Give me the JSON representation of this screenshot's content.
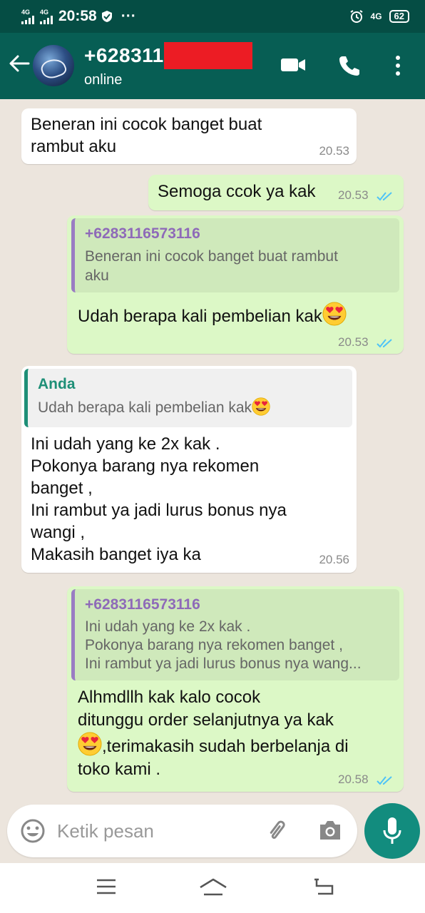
{
  "status_bar": {
    "network1": "4G",
    "network2": "4G",
    "time": "20:58",
    "dots": "···",
    "right_network": "4G",
    "battery": "62"
  },
  "header": {
    "contact": "+628311",
    "status": "online"
  },
  "messages": [
    {
      "dir": "in",
      "text_lines": [
        "Beneran ini cocok banget buat",
        "rambut aku"
      ],
      "time": "20.53"
    },
    {
      "dir": "out",
      "text": "Semoga ccok ya kak",
      "time": "20.53"
    },
    {
      "dir": "out",
      "quote_author": "+6283116573116",
      "quote_lines": [
        "Beneran ini cocok banget buat rambut",
        "aku"
      ],
      "text": "Udah berapa kali pembelian kak",
      "time": "20.53"
    },
    {
      "dir": "in",
      "quote_author": "Anda",
      "quote_text": "Udah berapa kali pembelian kak",
      "text_lines": [
        "Ini udah yang ke 2x kak .",
        "Pokonya barang nya rekomen",
        "banget ,",
        "Ini rambut ya jadi lurus bonus nya",
        "wangi ,",
        "Makasih banget iya ka"
      ],
      "time": "20.56"
    },
    {
      "dir": "out",
      "quote_author": "+6283116573116",
      "quote_lines": [
        "Ini udah yang ke 2x kak .",
        "Pokonya barang nya rekomen banget ,",
        "Ini rambut ya jadi lurus bonus nya wang..."
      ],
      "text_lines": [
        "Alhmdllh kak kalo cocok",
        "ditunggu order selanjutnya ya kak",
        ",terimakasih sudah berbelanja di",
        "toko kami ."
      ],
      "time": "20.58"
    }
  ],
  "input": {
    "placeholder": "Ketik pesan"
  },
  "icons": [
    "back-arrow-icon",
    "video-call-icon",
    "phone-icon",
    "more-options-icon",
    "emoji-icon",
    "attach-icon",
    "camera-icon",
    "mic-icon",
    "menu-icon",
    "home-icon",
    "back-icon",
    "double-check-icon",
    "heart-eyes-emoji"
  ],
  "colors": {
    "header": "#075e54",
    "statusbar": "#054d44",
    "outgoing": "#dcf8c6",
    "incoming": "#ffffff",
    "accent": "#128c7e",
    "read_ticks": "#4fc3f7"
  }
}
